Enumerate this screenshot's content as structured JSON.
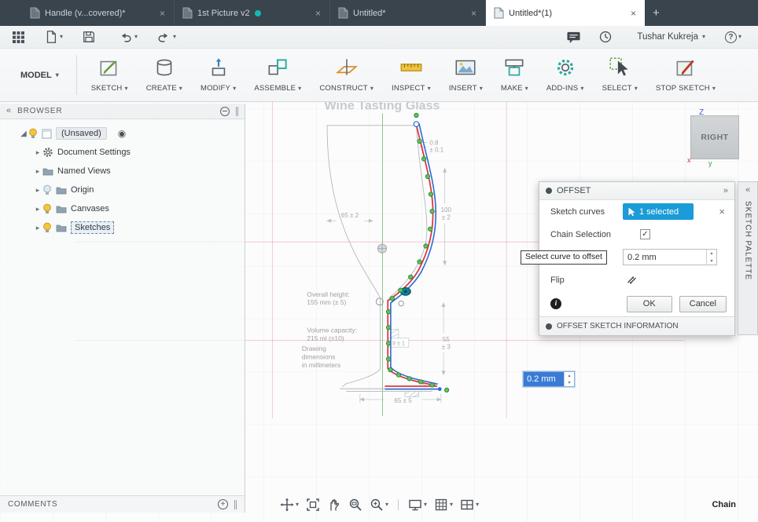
{
  "theme": {
    "accent_blue": "#1b9bd7",
    "selection_blue": "#3a7bd5",
    "sketch_red": "#d93a3a",
    "sketch_offset_blue": "#2e6bd4",
    "point_green": "#5cc25c",
    "tabbar_bg": "#39444d"
  },
  "icons": {
    "caret_down": "▾",
    "close": "×",
    "add_tab": "+",
    "collapse_chevrons": "«",
    "expand_chevrons": "»",
    "twisty": "▸",
    "twisty_open": "◢",
    "radio": "◉",
    "check": "✓",
    "spinner_up": "▴",
    "spinner_down": "▾",
    "info": "i",
    "plus": "+"
  },
  "tabbar": {
    "tabs": [
      {
        "label": "Handle (v...covered)*"
      },
      {
        "label": "1st Picture v2"
      },
      {
        "label": "Untitled*"
      },
      {
        "label": "Untitled*(1)"
      }
    ]
  },
  "qat": {
    "user_name": "Tushar Kukreja",
    "help_label": "?"
  },
  "ribbon": {
    "workspace_label": "MODEL",
    "groups": [
      {
        "label": "SKETCH"
      },
      {
        "label": "CREATE"
      },
      {
        "label": "MODIFY"
      },
      {
        "label": "ASSEMBLE"
      },
      {
        "label": "CONSTRUCT"
      },
      {
        "label": "INSPECT"
      },
      {
        "label": "INSERT"
      },
      {
        "label": "MAKE"
      },
      {
        "label": "ADD-INS"
      },
      {
        "label": "SELECT"
      },
      {
        "label": "STOP SKETCH"
      }
    ]
  },
  "browser": {
    "title": "BROWSER",
    "root_label": "(Unsaved)",
    "items": [
      {
        "label": "Document Settings"
      },
      {
        "label": "Named Views"
      },
      {
        "label": "Origin"
      },
      {
        "label": "Canvases"
      },
      {
        "label": "Sketches"
      }
    ]
  },
  "canvas": {
    "drawing_title": "Wine Tasting Glass",
    "viewcube_face": "RIGHT",
    "axis_z_label": "Z",
    "axis_x_label": "x",
    "axis_y_label": "y",
    "dimensions": {
      "rim_thickness": "0.8",
      "rim_thickness_tol": "± 0.1",
      "bowl_height": "100",
      "bowl_height_tol": "± 2",
      "bowl_width": "65 ± 2",
      "overall_height_label": "Overall height:",
      "overall_height_value": "155 mm (± 5)",
      "volume_label": "Volume capacity:",
      "volume_value": "215 ml (±10)",
      "note_line1": "Drawing",
      "note_line2": "dimensions",
      "note_line3": "in millimeters",
      "stem_height": "55",
      "stem_height_tol": "± 3",
      "stem_width": "9 ± 1",
      "base_width": "65 ± 5"
    }
  },
  "offset_dialog": {
    "title": "OFFSET",
    "sketch_curves_label": "Sketch curves",
    "selection_value": "1 selected",
    "chain_selection_label": "Chain Selection",
    "offset_value": "0.2 mm",
    "flip_label": "Flip",
    "ok_label": "OK",
    "cancel_label": "Cancel",
    "info_section_title": "OFFSET SKETCH INFORMATION"
  },
  "tooltip": {
    "text": "Select curve to offset"
  },
  "floating_input": {
    "value": "0.2 mm"
  },
  "sketch_palette": {
    "title": "SKETCH PALETTE"
  },
  "comments_panel": {
    "title": "COMMENTS"
  },
  "statusbar": {
    "mode_label": "Chain"
  }
}
